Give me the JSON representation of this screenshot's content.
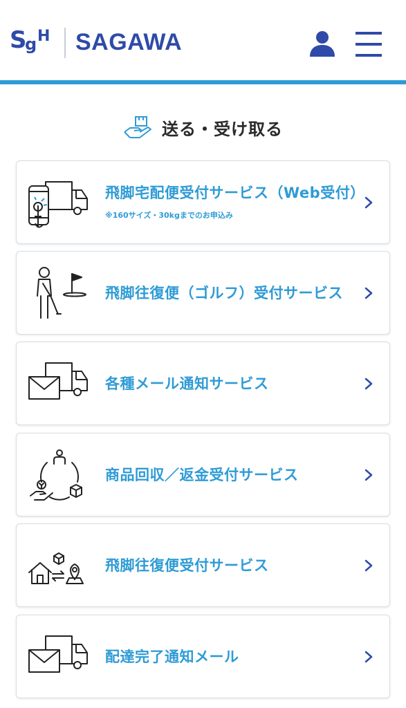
{
  "header": {
    "logo_mark_s": "S",
    "logo_mark_g": "g",
    "logo_mark_h": "H",
    "logo_text": "SAGAWA",
    "user_icon": "user-icon",
    "menu_icon": "hamburger-menu-icon",
    "accent_color": "#2e9bd6",
    "brand_color": "#2f4aa8"
  },
  "section": {
    "title": "送る・受け取る",
    "icon": "hand-package-icon"
  },
  "services": [
    {
      "label": "飛脚宅配便受付サービス（Web受付）",
      "sublabel": "※160サイズ・30kgまでのお申込み",
      "icon": "smartphone-truck-icon"
    },
    {
      "label": "飛脚往復便（ゴルフ）受付サービス",
      "icon": "golfer-flag-icon"
    },
    {
      "label": "各種メール通知サービス",
      "icon": "mail-truck-icon"
    },
    {
      "label": "商品回収／返金受付サービス",
      "icon": "return-refund-cycle-icon"
    },
    {
      "label": "飛脚往復便受付サービス",
      "icon": "house-package-location-icon"
    },
    {
      "label": "配達完了通知メール",
      "icon": "mail-truck-icon"
    }
  ]
}
